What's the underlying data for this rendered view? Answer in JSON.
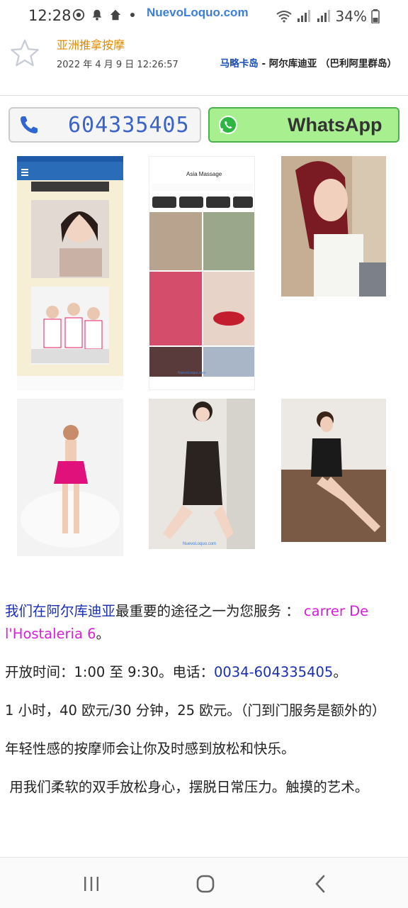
{
  "status_bar": {
    "time": "12:28",
    "watermark": "NuevoLoquo.com",
    "battery": "34%"
  },
  "header": {
    "category": "亚洲推拿按摩",
    "date": "2022 年 4 月 9 日 12:26:57",
    "location_link": "马略卡岛",
    "location_rest": " - 阿尔库迪亚 （巴利阿里群岛）"
  },
  "contact": {
    "phone": "604335405",
    "whatsapp_label": "WhatsApp"
  },
  "screenshot_app": {
    "title": "Asia Massage",
    "watermark": "NuevoLoquo.com"
  },
  "content": {
    "p1_link_blue": "我们在阿尔库迪亚",
    "p1_text": "最重要的途径之一为您服务 ： ",
    "p1_link_pink": "carrer De l'Hostaleria 6",
    "p1_end": "。",
    "p2_text": "开放时间：1:00 至 9:30。电话：",
    "p2_link": "0034-604335405",
    "p2_end": "。",
    "p3_text": "1 小时，40 欧元/30 分钟，25 欧元。（门到门服务是额外的）",
    "p4_text": "年轻性感的按摩师会让你及时感到放松和快乐。",
    "p5_text": " 用我们柔软的双手放松身心，摆脱日常压力。触摸的艺术。"
  },
  "colors": {
    "accent_orange": "#e08a00",
    "link_blue": "#1a2fb5",
    "link_pink": "#d61fd6",
    "whatsapp_green": "#a8ef8f"
  }
}
